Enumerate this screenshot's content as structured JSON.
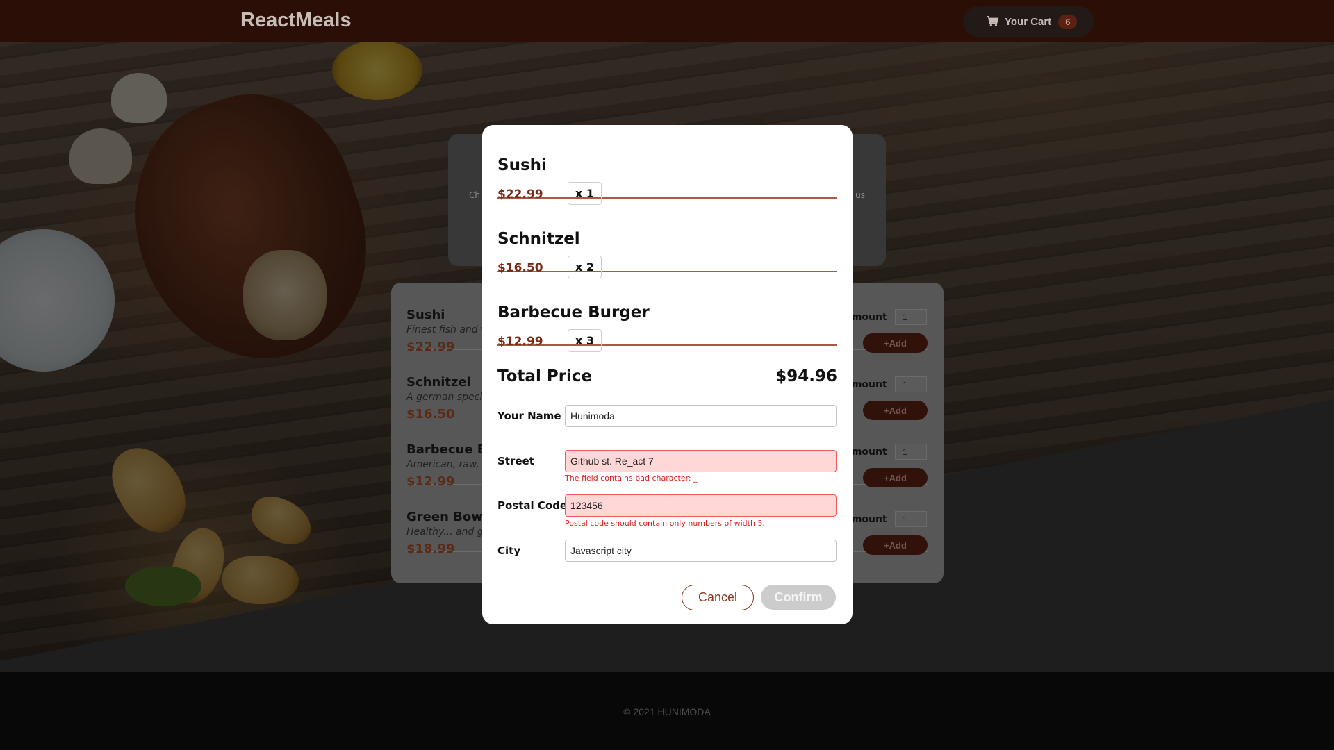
{
  "header": {
    "logo": "ReactMeals",
    "cart_label": "Your Cart",
    "cart_count": "6"
  },
  "summary": {
    "left_fragment": "Ch",
    "right_fragment": "us"
  },
  "meals": {
    "amount_label": "Amount",
    "add_label": "+Add",
    "items": [
      {
        "name": "Sushi",
        "description": "Finest fish and v",
        "price": "$22.99",
        "amount": "1"
      },
      {
        "name": "Schnitzel",
        "description": "A german speci",
        "price": "$16.50",
        "amount": "1"
      },
      {
        "name": "Barbecue Bu",
        "description": "American, raw, m",
        "price": "$12.99",
        "amount": "1"
      },
      {
        "name": "Green Bowl",
        "description": "Healthy... and gr",
        "price": "$18.99",
        "amount": "1"
      }
    ]
  },
  "modal": {
    "cart_items": [
      {
        "name": "Sushi",
        "price": "$22.99",
        "qty": "x 1"
      },
      {
        "name": "Schnitzel",
        "price": "$16.50",
        "qty": "x 2"
      },
      {
        "name": "Barbecue Burger",
        "price": "$12.99",
        "qty": "x 3"
      }
    ],
    "total_label": "Total Price",
    "total_value": "$94.96",
    "form": {
      "name_label": "Your Name",
      "name_value": "Hunimoda",
      "street_label": "Street",
      "street_value": "Github st. Re_act 7",
      "street_error": "The field contains bad character: _",
      "postal_label": "Postal Code",
      "postal_value": "123456",
      "postal_error": "Postal code should contain only numbers of width 5.",
      "city_label": "City",
      "city_value": "Javascript city"
    },
    "cancel_label": "Cancel",
    "confirm_label": "Confirm"
  },
  "footer": {
    "text": "© 2021 HUNIMODA"
  },
  "colors": {
    "header_bg": "#2b0f06",
    "accent": "#8a3a23",
    "price": "#7a2a16",
    "error": "#d92020",
    "invalid_bg": "#ffd7d7"
  },
  "icons": [
    "cart-icon"
  ]
}
